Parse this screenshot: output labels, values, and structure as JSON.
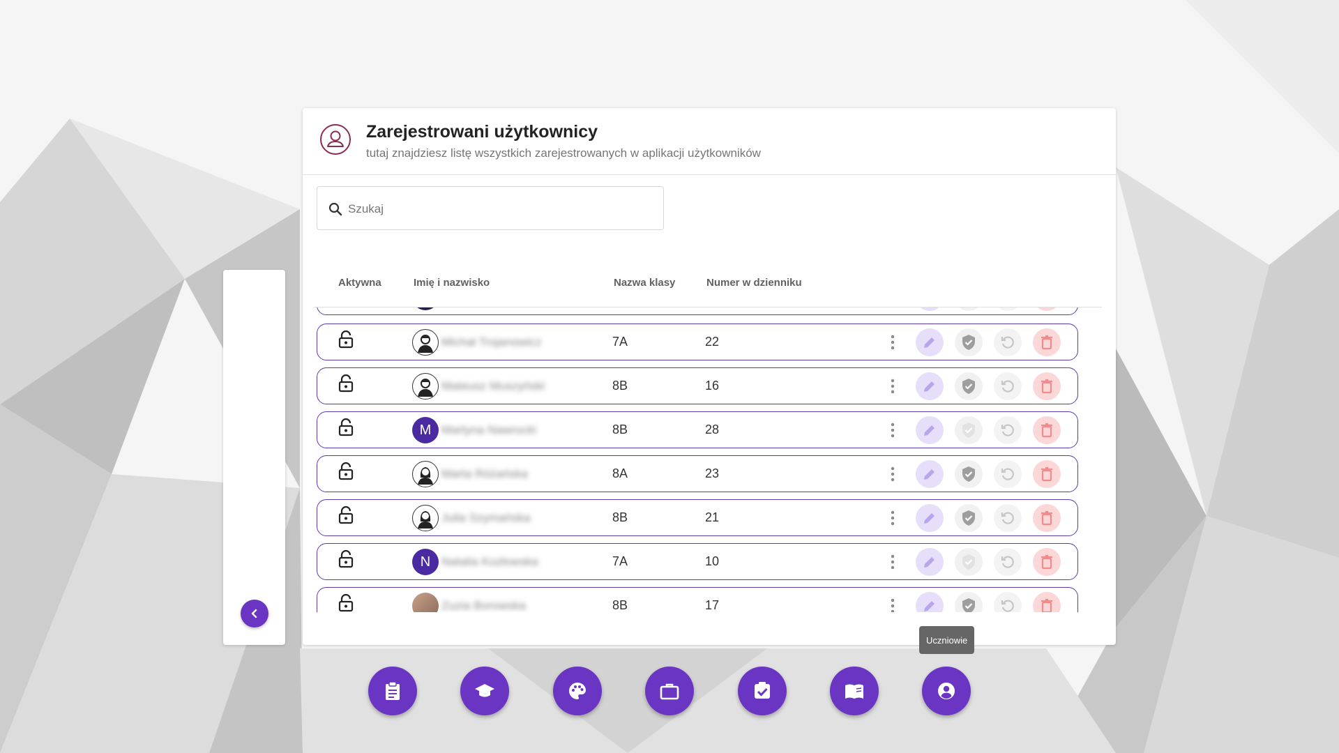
{
  "header": {
    "title": "Zarejestrowani użytkownicy",
    "subtitle": "tutaj znajdziesz listę wszystkich zarejestrowanych w aplikacji użytkowników"
  },
  "search": {
    "placeholder": "Szukaj",
    "value": ""
  },
  "columns": {
    "active": "Aktywna",
    "name": "Imię i nazwisko",
    "class": "Nazwa klasy",
    "number": "Numer w dzienniku"
  },
  "rows": [
    {
      "avatar": "male-avatar-icon",
      "avatar_letter": "",
      "name": "Michał Trojanowicz",
      "class": "7A",
      "number": "22",
      "verified": true
    },
    {
      "avatar": "male-avatar-icon",
      "avatar_letter": "",
      "name": "Mateusz Muszyński",
      "class": "8B",
      "number": "16",
      "verified": true
    },
    {
      "avatar": "letter",
      "avatar_letter": "M",
      "name": "Martyna Nawrocki",
      "class": "8B",
      "number": "28",
      "verified": false
    },
    {
      "avatar": "female-avatar-icon",
      "avatar_letter": "",
      "name": "Marta Różańska",
      "class": "8A",
      "number": "23",
      "verified": true
    },
    {
      "avatar": "female-avatar-icon",
      "avatar_letter": "",
      "name": "Julia Szymańska",
      "class": "8B",
      "number": "21",
      "verified": true
    },
    {
      "avatar": "letter",
      "avatar_letter": "N",
      "name": "Natalia Kozłowska",
      "class": "7A",
      "number": "10",
      "verified": false
    },
    {
      "avatar": "photo",
      "avatar_letter": "",
      "name": "Zuzia Borowska",
      "class": "8B",
      "number": "17",
      "verified": true
    }
  ],
  "dock": {
    "items": [
      {
        "icon": "clipboard-icon"
      },
      {
        "icon": "graduation-cap-icon"
      },
      {
        "icon": "palette-icon"
      },
      {
        "icon": "briefcase-icon"
      },
      {
        "icon": "checkbox-icon"
      },
      {
        "icon": "book-icon"
      },
      {
        "icon": "user-circle-icon"
      }
    ],
    "tooltip": "Uczniowie"
  },
  "colors": {
    "accent": "#6b35c4",
    "row_border": "#5b3aa8",
    "delete": "#f28c8c",
    "edit": "#b9a6ea"
  }
}
